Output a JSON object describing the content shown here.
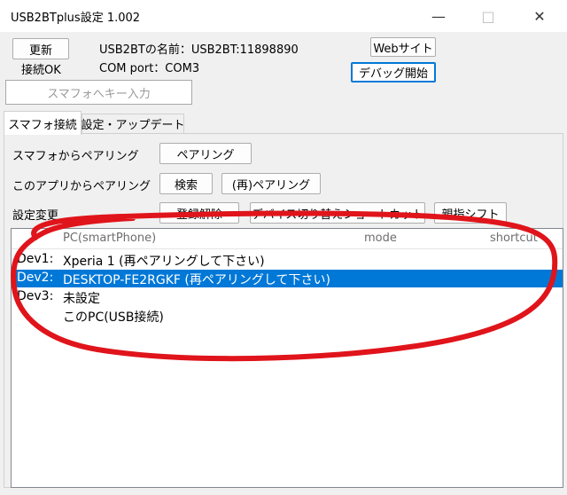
{
  "window": {
    "title": "USB2BTplus設定 1.002",
    "minimize_glyph": "—",
    "maximize_glyph": "□",
    "close_glyph": "✕"
  },
  "top": {
    "update_button": "更新",
    "connection_status": "接続OK",
    "device_name": "USB2BTの名前：USB2BT:11898890",
    "com_port": "COM port：COM3",
    "web_button": "Webサイト",
    "debug_button": "デバッグ開始",
    "key_input_placeholder": "スマフォへキー入力"
  },
  "tabs": [
    {
      "label": "スマフォ接続"
    },
    {
      "label": "設定・アップデート"
    }
  ],
  "pairing": {
    "from_phone_label": "スマフォからペアリング",
    "pair_button": "ペアリング",
    "from_app_label": "このアプリからペアリング",
    "search_button": "検索",
    "repair_button": "(再)ペアリング",
    "settings_change_label": "設定変更",
    "unregister_button": "登録解除",
    "shortcut_button": "デバイス切り替えショートカット",
    "thumb_shift_button": "親指シフト"
  },
  "list": {
    "columns": [
      "PC(smartPhone)",
      "mode",
      "shortcut"
    ],
    "rows": [
      {
        "id": "Dev1:",
        "name": "Xperia 1 (再ペアリングして下さい)",
        "selected": false
      },
      {
        "id": "Dev2:",
        "name": "DESKTOP-FE2RGKF (再ペアリングして下さい)",
        "selected": true
      },
      {
        "id": "Dev3:",
        "name": "未設定",
        "selected": false
      },
      {
        "id": "",
        "name": "このPC(USB接続)",
        "selected": false
      }
    ]
  },
  "colors": {
    "selection": "#0078d7",
    "annotation": "#e0141b"
  }
}
